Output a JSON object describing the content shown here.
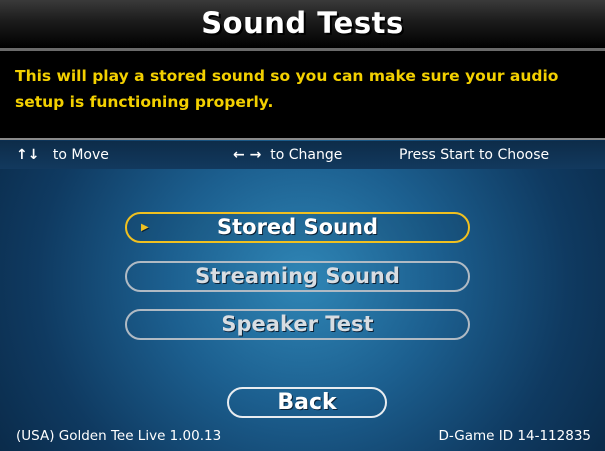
{
  "header": {
    "title": "Sound Tests"
  },
  "description": "This will play a stored sound so you can make sure your audio setup is functioning properly.",
  "help": {
    "move_icon": "↑↓",
    "move_label": "to Move",
    "change_icon": "← →",
    "change_label": "to Change",
    "choose_label": "Press Start to Choose"
  },
  "menu": {
    "items": [
      {
        "label": "Stored Sound"
      },
      {
        "label": "Streaming Sound"
      },
      {
        "label": "Speaker Test"
      }
    ],
    "cursor_icon": "▶",
    "back_label": "Back"
  },
  "footer": {
    "version": "(USA) Golden Tee Live 1.00.13",
    "game_id": "D-Game ID 14-112835"
  },
  "colors": {
    "accent_yellow": "#f0c020",
    "description_text": "#f3d000",
    "background_blue": "#1c5f8f"
  }
}
